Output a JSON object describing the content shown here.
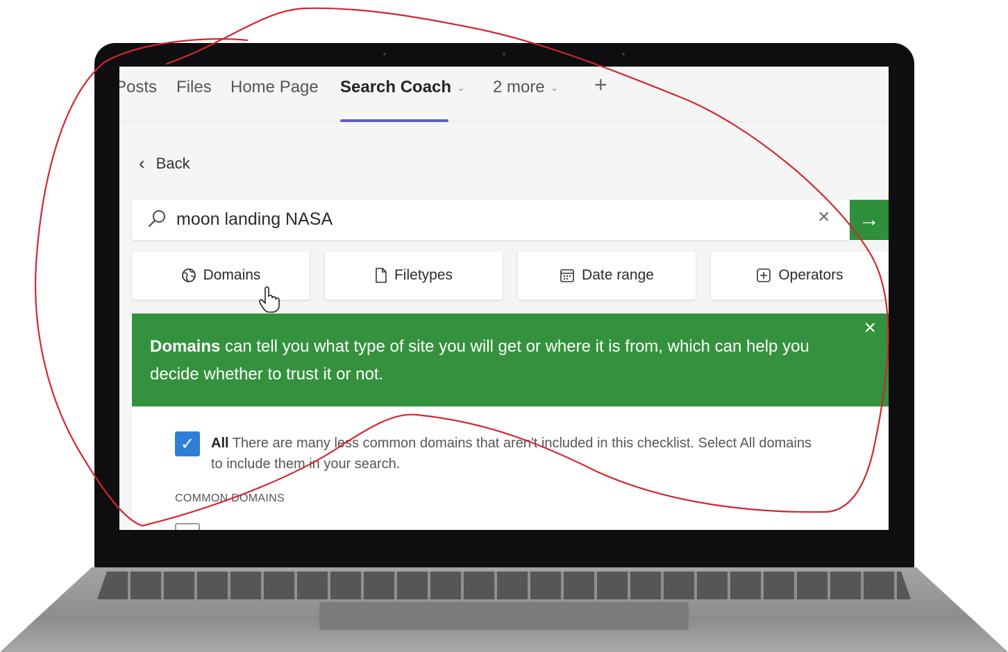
{
  "tabs": [
    {
      "label": "Posts"
    },
    {
      "label": "Files"
    },
    {
      "label": "Home Page"
    },
    {
      "label": "Search Coach"
    },
    {
      "label": "2 more"
    }
  ],
  "add_tab_icon": "plus-icon",
  "back": {
    "label": "Back"
  },
  "search": {
    "value": "moon landing NASA"
  },
  "filters": [
    {
      "label": "Domains",
      "icon": "globe-icon"
    },
    {
      "label": "Filetypes",
      "icon": "file-icon"
    },
    {
      "label": "Date range",
      "icon": "calendar-icon"
    },
    {
      "label": "Operators",
      "icon": "plus-box-icon"
    }
  ],
  "info": {
    "bold": "Domains",
    "text": " can tell you what type of site you will get or where it is from, which can help you decide whether to trust it or not."
  },
  "checklist": {
    "all_label": "All",
    "all_desc": " There are many less common domains that aren't included in this checklist. Select All domains to include them in your search.",
    "all_checked": true,
    "section": "COMMON DOMAINS"
  },
  "colors": {
    "accent_tab": "#5b5fc7",
    "green": "#34923e",
    "go_button": "#2f8f3b",
    "checkbox": "#2f7fd8",
    "annotation": "#d4252f"
  }
}
